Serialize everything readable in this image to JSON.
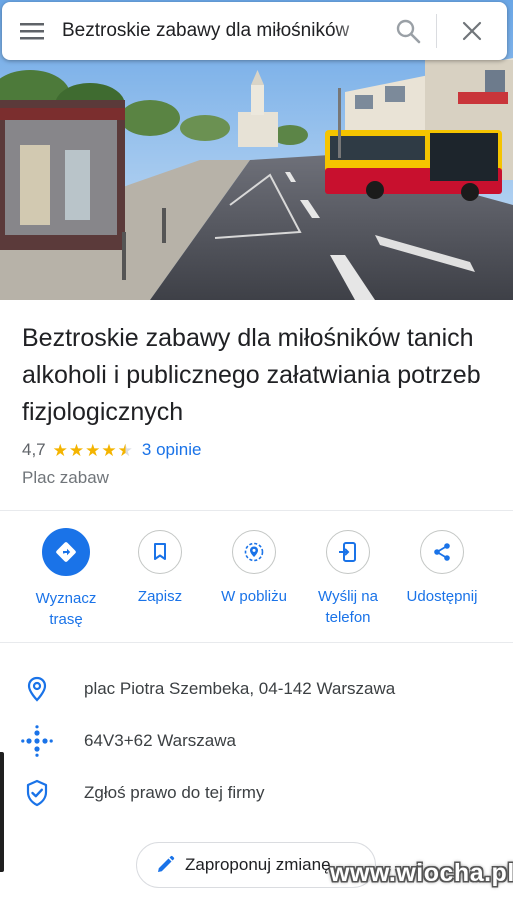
{
  "search": {
    "query": "Beztroskie zabawy dla miłośników"
  },
  "place": {
    "title": "Beztroskie zabawy dla miłośników tanich alkoholi i publicznego załatwiania potrzeb fizjologicznych",
    "rating": "4,7",
    "stars": 4.5,
    "reviews": "3 opinie",
    "category": "Plac zabaw"
  },
  "actions": [
    {
      "label": "Wyznacz trasę",
      "icon": "directions-icon"
    },
    {
      "label": "Zapisz",
      "icon": "bookmark-icon"
    },
    {
      "label": "W pobliżu",
      "icon": "nearby-icon"
    },
    {
      "label": "Wyślij na telefon",
      "icon": "send-to-phone-icon"
    },
    {
      "label": "Udostępnij",
      "icon": "share-icon"
    }
  ],
  "info": {
    "address": "plac Piotra Szembeka, 04-142 Warszawa",
    "plus_code": "64V3+62 Warszawa",
    "claim": "Zgłoś prawo do tej firmy"
  },
  "suggest_edit": {
    "label": "Zaproponuj zmianę"
  },
  "watermark": "www.wiocha.pl",
  "colors": {
    "accent": "#1a73e8",
    "star": "#f4b400",
    "bus_red": "#c8102e",
    "bus_yellow": "#f5c400"
  }
}
